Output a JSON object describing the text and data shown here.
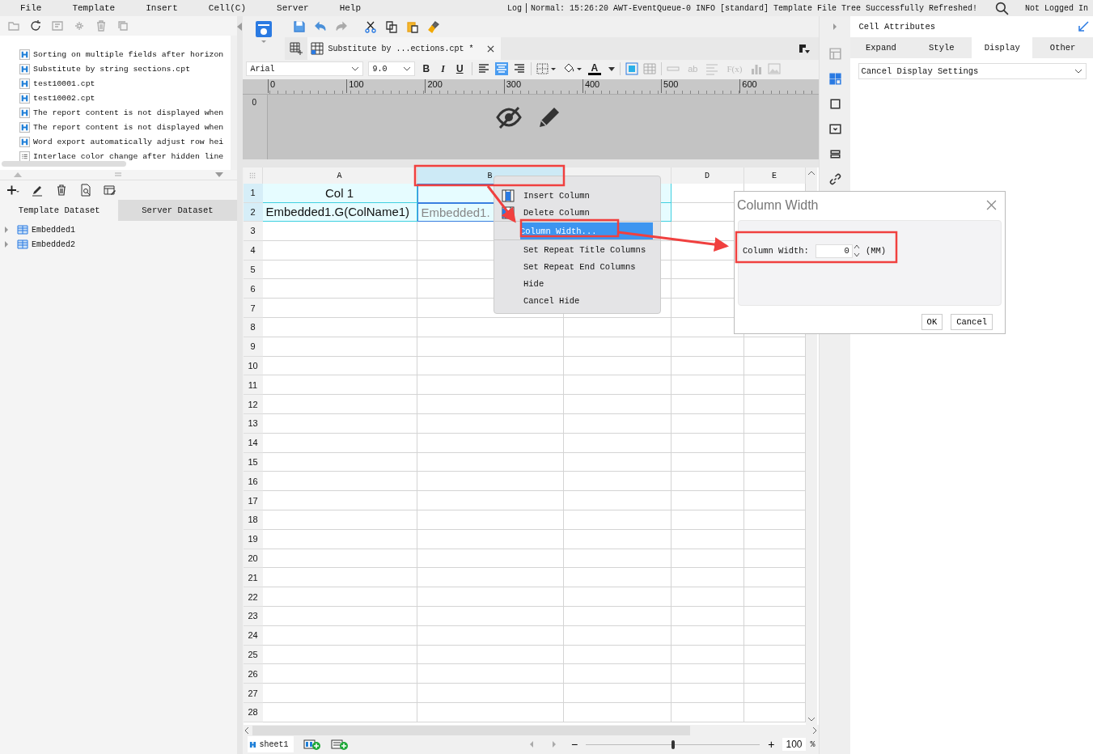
{
  "menu": [
    "File",
    "Template",
    "Insert",
    "Cell(C)",
    "Server",
    "Help"
  ],
  "log": {
    "label": "Log",
    "message": "Normal: 15:26:20 AWT-EventQueue-0 INFO [standard] Template File Tree Successfully Refreshed!"
  },
  "user": "Not Logged In",
  "file_tree": [
    {
      "name": "Sorting on multiple fields after horizon",
      "kind": "report"
    },
    {
      "name": "Substitute by string sections.cpt",
      "kind": "report"
    },
    {
      "name": "test10001.cpt",
      "kind": "report"
    },
    {
      "name": "test10002.cpt",
      "kind": "report"
    },
    {
      "name": "The report content is not displayed when",
      "kind": "report"
    },
    {
      "name": "The report content is not displayed when",
      "kind": "report"
    },
    {
      "name": "Word export automatically adjust row hei",
      "kind": "report"
    },
    {
      "name": "Interlace color change after hidden line",
      "kind": "list"
    }
  ],
  "dataset_tabs": [
    {
      "label": "Template Dataset",
      "selected": true
    },
    {
      "label": "Server Dataset",
      "selected": false
    }
  ],
  "datasets": [
    {
      "name": "Embedded1",
      "expanded": false
    },
    {
      "name": "Embedded2",
      "expanded": false
    }
  ],
  "doc_tab": {
    "title": "Substitute by ...ections.cpt *",
    "selected": true
  },
  "format_bar": {
    "font": "Arial",
    "size": "9.0",
    "text_buttons": [
      {
        "label": "B",
        "disabled": false
      },
      {
        "label": "I",
        "disabled": false
      },
      {
        "label": "U",
        "disabled": false
      },
      {
        "label": "A",
        "disabled": false
      },
      {
        "label": "ab",
        "disabled": true
      },
      {
        "label": "F(x)",
        "disabled": true
      }
    ]
  },
  "ruler": {
    "marks": [
      "0",
      "100",
      "200",
      "300",
      "400",
      "500",
      "600"
    ],
    "vertical": "0"
  },
  "grid": {
    "columns": [
      {
        "label": "A",
        "selected": false
      },
      {
        "label": "B",
        "selected": true
      },
      {
        "selected": false
      },
      {
        "label": "D",
        "selected": false
      },
      {
        "label": "E",
        "selected": false
      }
    ],
    "rows": [
      {
        "number": "1",
        "selected": true,
        "cells": [
          {
            "text": "Col 1",
            "selected": true
          },
          {
            "selected": true
          },
          {
            "selected": true
          }
        ]
      },
      {
        "number": "2",
        "selected": true,
        "cells": [
          {
            "text": "Embedded1.G(ColName1)",
            "selected": true
          },
          {
            "text": "Embedded1.",
            "selected": true
          },
          {
            "selected": true
          }
        ]
      },
      {
        "number": "3",
        "selected": false
      },
      {
        "number": "4",
        "selected": false
      },
      {
        "number": "5",
        "selected": false
      },
      {
        "number": "6",
        "selected": false
      },
      {
        "number": "7",
        "selected": false
      },
      {
        "number": "8",
        "selected": false
      },
      {
        "number": "9",
        "selected": false
      },
      {
        "number": "10",
        "selected": false
      },
      {
        "number": "11",
        "selected": false
      },
      {
        "number": "12",
        "selected": false
      },
      {
        "number": "13",
        "selected": false
      },
      {
        "number": "14",
        "selected": false
      },
      {
        "number": "15",
        "selected": false
      },
      {
        "number": "16",
        "selected": false
      },
      {
        "number": "17",
        "selected": false
      },
      {
        "number": "18",
        "selected": false
      },
      {
        "number": "19",
        "selected": false
      },
      {
        "number": "20",
        "selected": false
      },
      {
        "number": "21",
        "selected": false
      },
      {
        "number": "22",
        "selected": false
      },
      {
        "number": "23",
        "selected": false
      },
      {
        "number": "24",
        "selected": false
      },
      {
        "number": "25",
        "selected": false
      },
      {
        "number": "26",
        "selected": false
      },
      {
        "number": "27",
        "selected": false
      },
      {
        "number": "28",
        "selected": false
      }
    ]
  },
  "context_menu": [
    {
      "label": "Insert Column",
      "kind": "insert",
      "selected": false
    },
    {
      "label": "Delete Column",
      "kind": "delete",
      "selected": false
    },
    {
      "label": "Column Width...",
      "kind": "plain",
      "selected": true
    },
    {
      "label": "Set Repeat Title Columns",
      "kind": "plain",
      "selected": false
    },
    {
      "label": "Set Repeat End Columns",
      "kind": "plain",
      "selected": false
    },
    {
      "label": "Hide",
      "kind": "plain",
      "selected": false
    },
    {
      "label": "Cancel Hide",
      "kind": "plain",
      "selected": false
    }
  ],
  "dialog": {
    "title": "Column Width",
    "field_label": "Column Width:",
    "value": "0",
    "unit": "(MM)",
    "buttons": [
      "OK",
      "Cancel"
    ]
  },
  "sheets": [
    {
      "label": "sheet1",
      "selected": true
    }
  ],
  "zoom": {
    "minus": "−",
    "plus": "+",
    "level": 0.5,
    "value": "100",
    "unit": "%"
  },
  "right_panel": {
    "title": "Cell Attributes",
    "tabs": [
      {
        "label": "Expand",
        "selected": false
      },
      {
        "label": "Style",
        "selected": false
      },
      {
        "label": "Display",
        "selected": true
      },
      {
        "label": "Other",
        "selected": false
      }
    ],
    "select": "Cancel Display Settings"
  }
}
